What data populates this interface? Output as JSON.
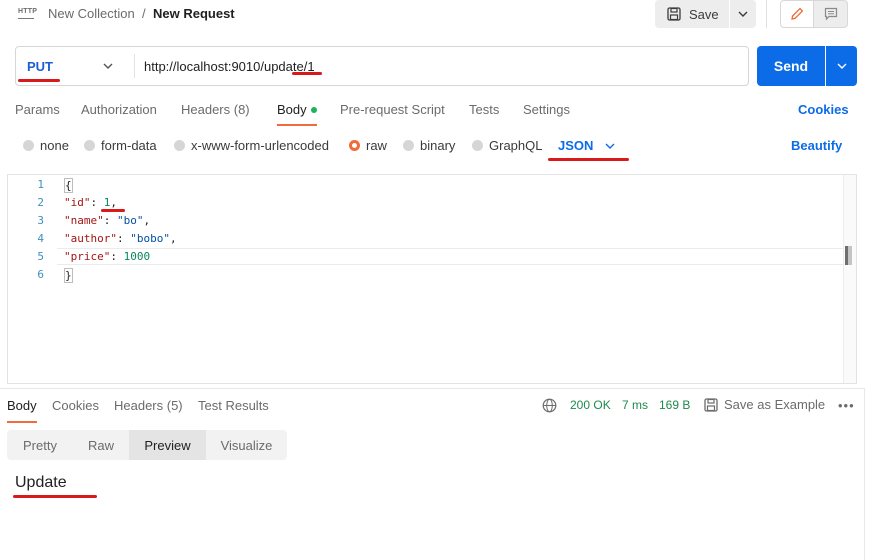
{
  "header": {
    "icon_text": "HTTP",
    "collection": "New Collection",
    "separator": "/",
    "request_name": "New Request",
    "save_label": "Save"
  },
  "request": {
    "method": "PUT",
    "url": "http://localhost:9010/update/1",
    "send_label": "Send"
  },
  "tabs": {
    "params": "Params",
    "authorization": "Authorization",
    "headers": "Headers (8)",
    "body": "Body",
    "prerequest": "Pre-request Script",
    "tests": "Tests",
    "settings": "Settings",
    "cookies": "Cookies"
  },
  "body_types": {
    "none": "none",
    "form_data": "form-data",
    "urlencoded": "x-www-form-urlencoded",
    "raw": "raw",
    "binary": "binary",
    "graphql": "GraphQL",
    "format": "JSON",
    "beautify": "Beautify"
  },
  "editor": {
    "line_numbers": [
      "1",
      "2",
      "3",
      "4",
      "5",
      "6"
    ],
    "open_brace": "{",
    "close_brace": "}",
    "lines": [
      {
        "key": "\"id\"",
        "sep": ": ",
        "value": "1",
        "tail": ","
      },
      {
        "key": "\"name\"",
        "sep": ": ",
        "value": "\"bo\"",
        "tail": ","
      },
      {
        "key": "\"author\"",
        "sep": ": ",
        "value": "\"bobo\"",
        "tail": ","
      },
      {
        "key": "\"price\"",
        "sep": ": ",
        "value": "1000",
        "tail": ""
      }
    ]
  },
  "response": {
    "tabs": {
      "body": "Body",
      "cookies": "Cookies",
      "headers": "Headers (5)",
      "test_results": "Test Results"
    },
    "status": "200 OK",
    "time": "7 ms",
    "size": "169 B",
    "save_example": "Save as Example",
    "more": "•••",
    "views": [
      "Pretty",
      "Raw",
      "Preview",
      "Visualize"
    ],
    "active_view": "Preview",
    "preview_text": "Update"
  },
  "colors": {
    "accent_orange": "#f26b3a",
    "send_blue": "#0c6ce8",
    "method_blue": "#1d5ed6",
    "status_green": "#1e8a4b",
    "annotation_red": "#d91a1a"
  }
}
